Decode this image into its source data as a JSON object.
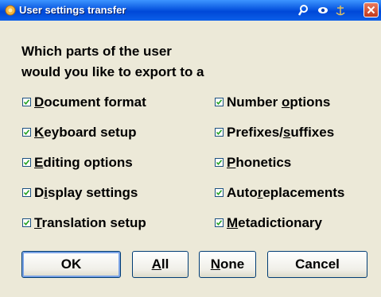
{
  "window": {
    "title": "User settings transfer",
    "title_icons": [
      "search-icon",
      "eye-icon",
      "anchor-icon"
    ],
    "close_icon": "close-icon"
  },
  "prompt": {
    "line1": "Which parts of the user",
    "line2": "would you like to export to a"
  },
  "options_left": [
    {
      "pre": "",
      "u": "D",
      "post": "ocument format",
      "checked": true
    },
    {
      "pre": "",
      "u": "K",
      "post": "eyboard setup",
      "checked": true
    },
    {
      "pre": "",
      "u": "E",
      "post": "diting options",
      "checked": true
    },
    {
      "pre": "D",
      "u": "i",
      "post": "splay settings",
      "checked": true
    },
    {
      "pre": "",
      "u": "T",
      "post": "ranslation setup",
      "checked": true
    }
  ],
  "options_right": [
    {
      "pre": "Number ",
      "u": "o",
      "post": "ptions",
      "checked": true
    },
    {
      "pre": "Prefixes/",
      "u": "s",
      "post": "uffixes",
      "checked": true
    },
    {
      "pre": "",
      "u": "P",
      "post": "honetics",
      "checked": true
    },
    {
      "pre": "Auto",
      "u": "r",
      "post": "eplacements",
      "checked": true
    },
    {
      "pre": "",
      "u": "M",
      "post": "etadictionary",
      "checked": true
    }
  ],
  "buttons": {
    "ok": "OK",
    "all_u": "A",
    "all_post": "ll",
    "none_u": "N",
    "none_post": "one",
    "cancel": "Cancel"
  },
  "colors": {
    "titlebar": "#0a58e0",
    "dialog_bg": "#ece9d8",
    "checkbox_border": "#1c5180",
    "checkmark": "#21a121",
    "close_button": "#c1391c"
  }
}
